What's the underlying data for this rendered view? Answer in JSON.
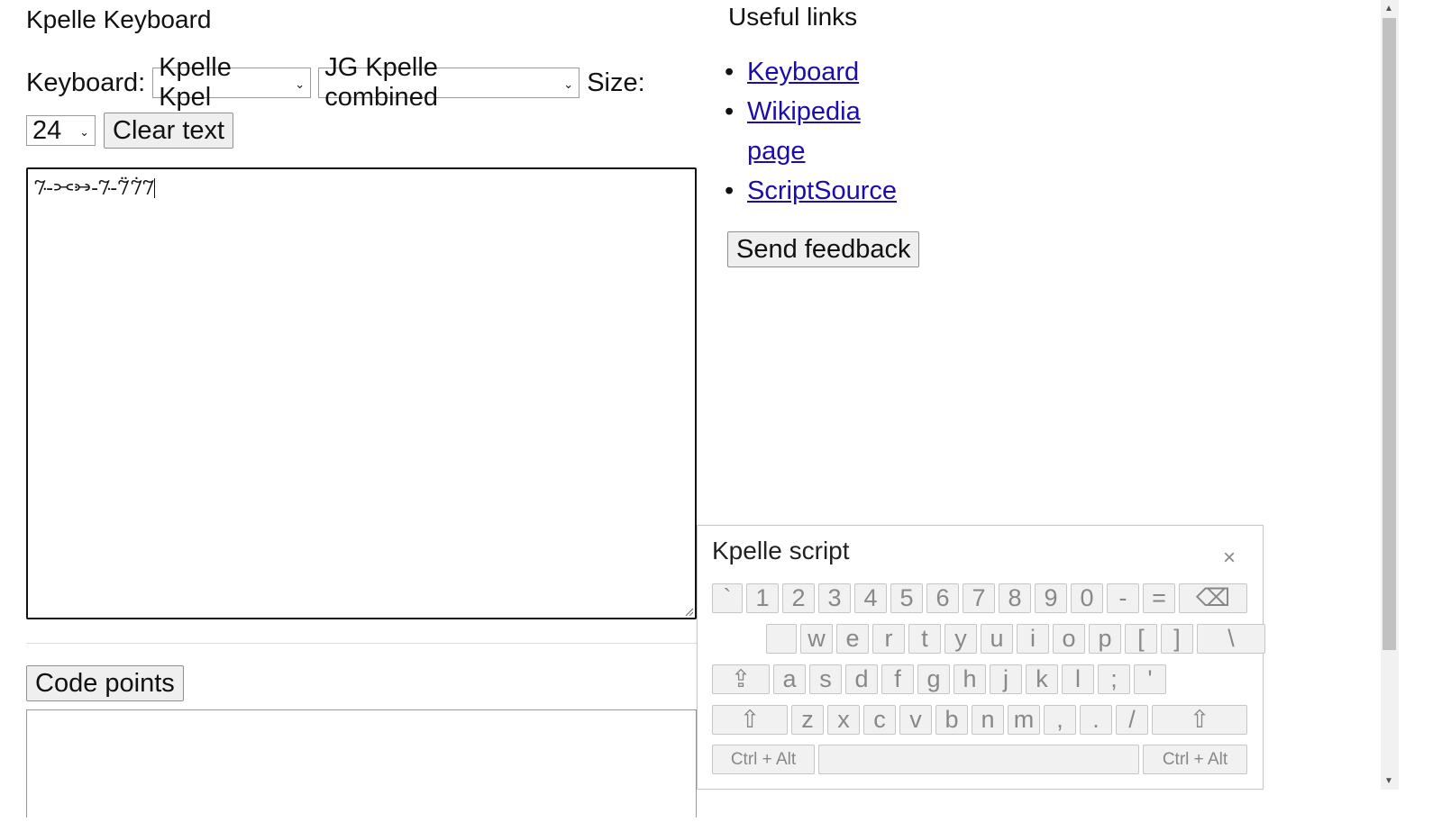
{
  "page": {
    "title": "Kpelle Keyboard"
  },
  "controls": {
    "keyboard_label": "Keyboard:",
    "keyboard_select": "Kpelle Kpel",
    "layout_select": "JG Kpelle combined",
    "size_label": "Size:",
    "size_select": "24",
    "clear_button": "Clear text"
  },
  "editor": {
    "text": "𞠀𞠁𞠂-𞠃-𞠄𞠅-𞠃"
  },
  "codepoints": {
    "button_label": "Code points"
  },
  "links": {
    "title": "Useful links",
    "items": [
      {
        "label": "Keyboard"
      },
      {
        "label": "Wikipedia page"
      },
      {
        "label": "ScriptSource"
      }
    ],
    "feedback_button": "Send feedback"
  },
  "virtual_keyboard": {
    "title": "Kpelle script",
    "close": "×",
    "rows": [
      [
        "`",
        "1",
        "2",
        "3",
        "4",
        "5",
        "6",
        "7",
        "8",
        "9",
        "0",
        "-",
        "=",
        "⌫"
      ],
      [
        "",
        "w",
        "e",
        "r",
        "t",
        "y",
        "u",
        "i",
        "o",
        "p",
        "[",
        "]",
        "\\"
      ],
      [
        "⇪",
        "a",
        "s",
        "d",
        "f",
        "g",
        "h",
        "j",
        "k",
        "l",
        ";",
        "'"
      ],
      [
        "⇧",
        "z",
        "x",
        "c",
        "v",
        "b",
        "n",
        "m",
        ",",
        ".",
        "/",
        "⇧"
      ],
      [
        "Ctrl + Alt",
        "",
        "Ctrl + Alt"
      ]
    ]
  }
}
